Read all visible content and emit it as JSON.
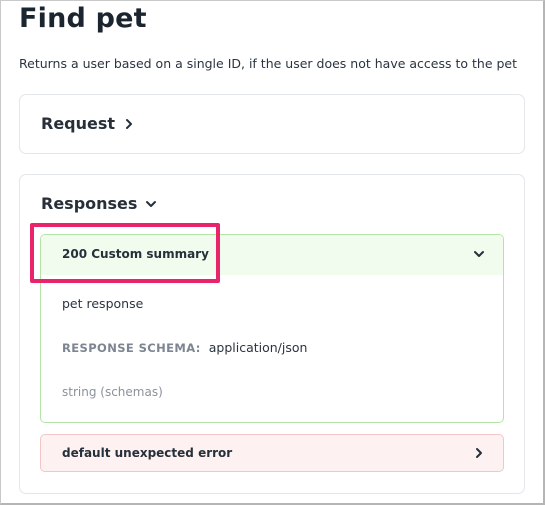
{
  "page": {
    "title": "Find pet",
    "description": "Returns a user based on a single ID, if the user does not have access to the pet"
  },
  "request": {
    "label": "Request",
    "icon": "chevron-right-icon"
  },
  "responses": {
    "label": "Responses",
    "icon": "chevron-down-icon",
    "items": [
      {
        "code_label": "200 Custom summary",
        "icon": "chevron-down-icon",
        "description": "pet response",
        "schema_label": "RESPONSE SCHEMA:",
        "schema_type": "application/json",
        "schema_value": "string (schemas)",
        "accent": "#b4e4a6"
      },
      {
        "code_label": "default unexpected error",
        "icon": "chevron-right-icon",
        "accent": "#f3c6c6"
      }
    ]
  },
  "highlight": {
    "color": "#e8246a"
  }
}
